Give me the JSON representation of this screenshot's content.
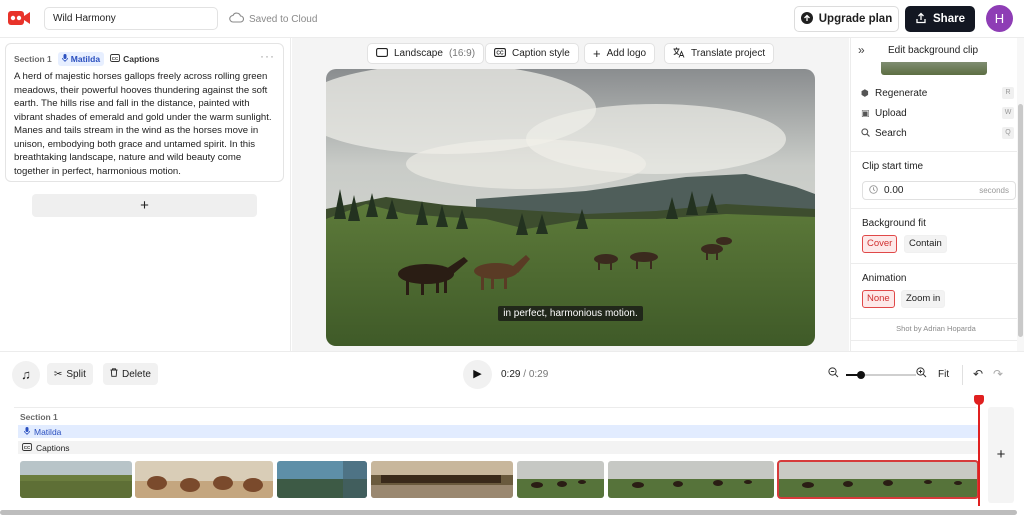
{
  "header": {
    "project_title": "Wild Harmony",
    "save_status": "Saved to Cloud",
    "upgrade_label": "Upgrade plan",
    "share_label": "Share",
    "avatar_initial": "H"
  },
  "script_panel": {
    "section": {
      "title": "Section 1",
      "voice": "Matilda",
      "captions": "Captions",
      "more": "···",
      "text": "A herd of majestic horses gallops freely across rolling green meadows, their powerful hooves thundering against the soft earth. The hills rise and fall in the distance, painted with vibrant shades of emerald and gold under the warm sunlight. Manes and tails stream in the wind as the horses move in unison, embodying both grace and untamed spirit. In this breathtaking landscape, nature and wild beauty come together in perfect, harmonious motion."
    },
    "add_section": "+"
  },
  "canvas_toolbar": {
    "aspect_label": "Landscape",
    "aspect_ratio": "(16:9)",
    "caption_style": "Caption style",
    "add_logo": "Add logo",
    "translate": "Translate project"
  },
  "preview": {
    "subtitle": "in perfect, harmonious motion."
  },
  "clip_panel": {
    "title": "Edit background clip",
    "actions": [
      {
        "label": "Regenerate",
        "key": "R"
      },
      {
        "label": "Upload",
        "key": "W"
      },
      {
        "label": "Search",
        "key": "Q"
      }
    ],
    "start_time_label": "Clip start time",
    "start_time_value": "0.00",
    "start_time_unit": "seconds",
    "fit_label": "Background fit",
    "fit_options": [
      "Cover",
      "Contain"
    ],
    "fit_selected": "Cover",
    "animation_label": "Animation",
    "animation_options": [
      "None",
      "Zoom in"
    ],
    "animation_selected": "None",
    "credit": "Shot by Adrian Hoparda"
  },
  "controls": {
    "split": "Split",
    "delete": "Delete",
    "current_time": "0:29",
    "separator": " / ",
    "total_time": "0:29",
    "fit": "Fit",
    "zoom_level": 0.2
  },
  "timeline": {
    "section_label": "Section 1",
    "voice_label": "Matilda",
    "captions_label": "Captions",
    "clips": 7,
    "add": "+"
  },
  "colors": {
    "accent_red": "#e02020",
    "brand_dark": "#131722",
    "avatar_purple": "#8e3db5",
    "voice_blue": "#2a4fbf"
  }
}
